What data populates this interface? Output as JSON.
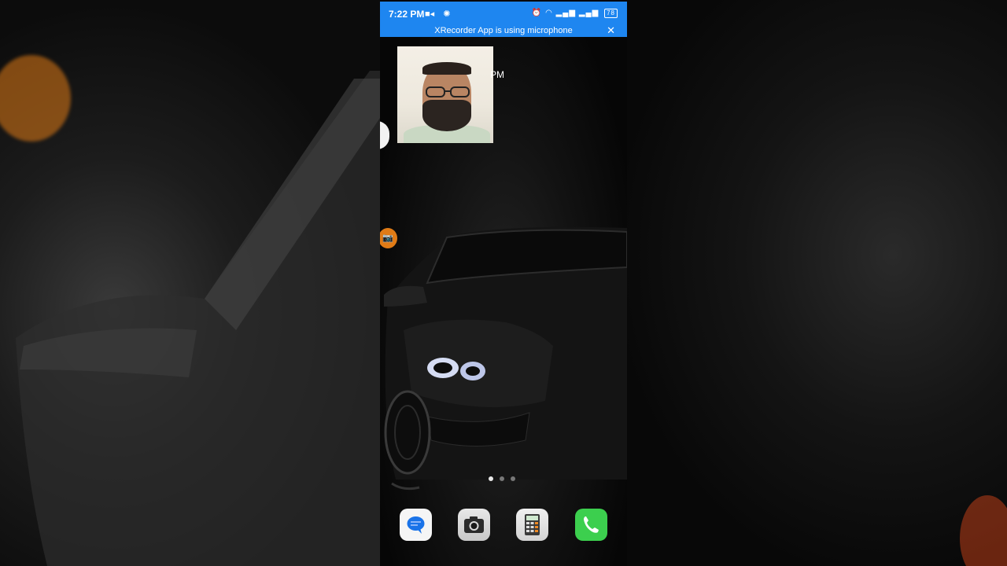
{
  "status_bar": {
    "time": "7:22 PM",
    "left_icons": [
      "video-record-icon",
      "settings-gear-icon"
    ],
    "right_icons": [
      "alarm-icon",
      "wifi-icon",
      "signal-icon",
      "signal-icon-2",
      "data-speed-icon",
      "battery-icon"
    ],
    "battery_level": "78",
    "background_color": "#1e86f0"
  },
  "mic_banner": {
    "text": "XRecorder App is using microphone",
    "close_symbol": "✕"
  },
  "clock_fragment": "PM",
  "floating_camera_symbol": "📷",
  "page_indicator": {
    "pages": 3,
    "active": 0
  },
  "dock": {
    "apps": [
      {
        "name": "Messages",
        "icon": "messages-icon",
        "color": "#1a73e8"
      },
      {
        "name": "Camera",
        "icon": "camera-icon",
        "color": "#c8c8c8"
      },
      {
        "name": "Calculator",
        "icon": "calculator-icon",
        "color": "#d3d3d3"
      },
      {
        "name": "Phone",
        "icon": "phone-icon",
        "color": "#3ccf4e"
      }
    ]
  }
}
